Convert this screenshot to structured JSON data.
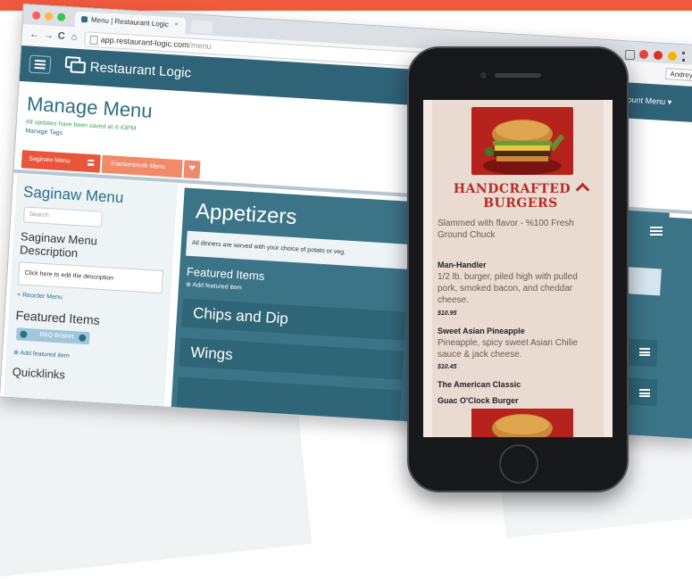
{
  "browser": {
    "tab_title": "Menu | Restaurant Logic",
    "tab_close": "×",
    "url_host": "app.restaurant-logic.com",
    "url_path": "/menu",
    "account_button": "Andrey",
    "colors": {
      "close": "#fc605b",
      "min": "#fdbc40",
      "max": "#34c84a"
    }
  },
  "app": {
    "brand": "Restaurant Logic",
    "account_menu": "Account Menu",
    "page_title": "Manage Menu",
    "saved_status": "All updates have been saved at 4:43PM",
    "manage_tags": "Manage Tags",
    "menu_tabs": [
      "Saginaw Menu",
      "Frankenmuth Menu"
    ],
    "accent": "#2a6f86",
    "tab_accent": "#e8553a"
  },
  "sidebar": {
    "title": "Saginaw Menu",
    "search_placeholder": "Search",
    "description_title": "Saginaw Menu Description",
    "description_prompt": "Click here to edit the description",
    "reorder": "+ Reorder Menu",
    "featured_title": "Featured Items",
    "featured_chip": "BBQ Brisket",
    "add_featured": "Add featured item",
    "quicklinks": "Quicklinks"
  },
  "main": {
    "section_title": "Appetizers",
    "note": "All dinners are served with your choice of potato or veg.",
    "featured": "Featured Items",
    "add_featured": "Add featured item",
    "categories": [
      "Chips and Dip",
      "Wings"
    ]
  },
  "phone": {
    "heading_line1": "HANDCRAFTED",
    "heading_line2": "BURGERS",
    "subtitle": "Slammed with flavor - %100 Fresh Ground Chuck",
    "items": [
      {
        "name": "Man-Handler",
        "desc": "1/2 lb. burger, piled high with pulled pork, smoked bacon, and cheddar cheese.",
        "price": "$10.95"
      },
      {
        "name": "Sweet Asian Pineapple",
        "desc": "Pineapple, spicy sweet Asian Chilie sauce & jack cheese.",
        "price": "$10.45"
      },
      {
        "name": "The American Classic",
        "desc": "",
        "price": ""
      },
      {
        "name": "Guac O'Clock Burger",
        "desc": "",
        "price": ""
      }
    ]
  }
}
